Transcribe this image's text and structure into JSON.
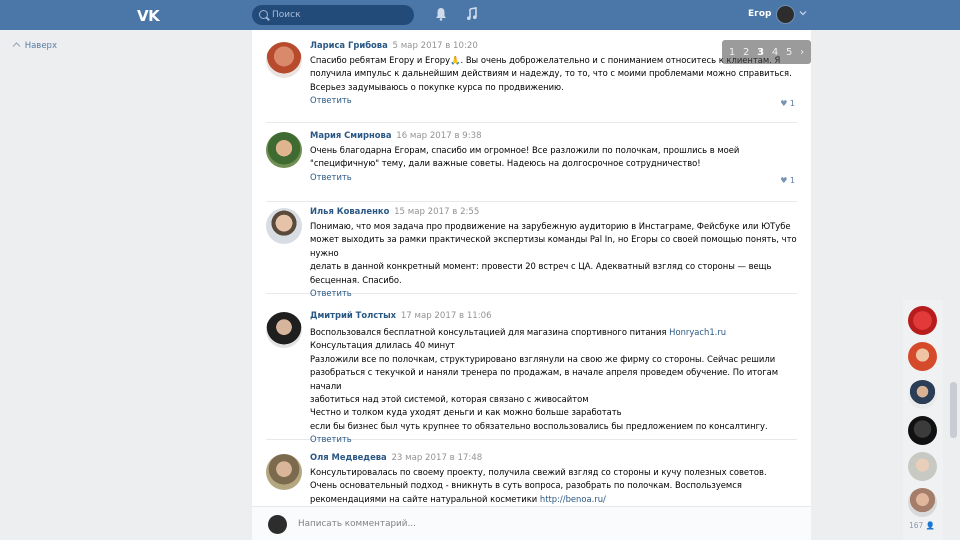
{
  "header": {
    "logo": "VK",
    "search_placeholder": "Поиск",
    "user_name": "Егор"
  },
  "left_nav": {
    "back_label": "Наверх"
  },
  "pager": {
    "pages": [
      "1",
      "2",
      "3",
      "4",
      "5",
      "›"
    ],
    "current": "3"
  },
  "comments": [
    {
      "author": "Лариса Грибова",
      "date": "5 мар 2017 в 10:20",
      "text": "Спасибо ребятам Егору и Егору🙏. Вы очень доброжелательно и с пониманием относитесь к клиентам. Я\nполучила импульс к дальнейшим действиям и надежду, то то, что с моими проблемами можно справиться.\nВсерьез задумываюсь о покупке курса по продвижению.",
      "reply": "Ответить",
      "likes": "1"
    },
    {
      "author": "Мария Смирнова",
      "date": "16 мар 2017 в 9:38",
      "text": "Очень благодарна Егорам, спасибо им огромное! Все разложили по полочкам, прошлись в моей\n\"специфичную\" тему, дали важные советы. Надеюсь на долгосрочное сотрудничество!",
      "reply": "Ответить",
      "likes": "1"
    },
    {
      "author": "Илья Коваленко",
      "date": "15 мар 2017 в 2:55",
      "text": "Понимаю, что моя задача про продвижение на зарубежную аудиторию в Инстаграме, Фейсбуке или ЮТубе\nможет выходить за рамки практической экспертизы команды Pal In, но Егоры со своей помощью понять, что нужно\nделать в данной конкретный момент: провести 20 встреч с ЦА. Адекватный взгляд со стороны — вещь\nбесценная. Спасибо.",
      "reply": "Ответить",
      "likes": ""
    },
    {
      "author": "Дмитрий Толстых",
      "date": "17 мар 2017 в 11:06",
      "text_before_link": "Воспользовался бесплатной консультацией для магазина спортивного питания ",
      "link": "Honryach1.ru",
      "text": "Консультация длилась 40 минут\nРазложили все по полочкам, структурировано взглянули на свою же фирму со стороны. Сейчас решили\nразобраться с текучкой и наняли тренера по продажам, в начале апреля проведем обучение. По итогам начали\nзаботиться над этой системой, которая связано с живосайтом\nЧестно и толком куда уходят деньги и как можно больше заработать\nесли бы бизнес был чуть крупнее то обязательно воспользовались бы предложением по консалтингу.",
      "reply": "Ответить",
      "likes": ""
    },
    {
      "author": "Оля Медведева",
      "date": "23 мар 2017 в 17:48",
      "text_before_link": "Консультировалась по своему проекту, получила свежий взгляд со стороны и кучу полезных советов.\nОчень основательный подход - вникнуть в суть вопроса, разобрать по полочкам. Воспользуемся\nрекомендациями на сайте натуральной косметики ",
      "link": "http://benoa.ru/",
      "reply": "",
      "likes": ""
    }
  ],
  "composer": {
    "placeholder": "Написать комментарий..."
  },
  "right_rail": {
    "count": "167"
  },
  "colors": {
    "header": "#4a76a8",
    "link": "#2a5885",
    "bg": "#edeef0"
  }
}
